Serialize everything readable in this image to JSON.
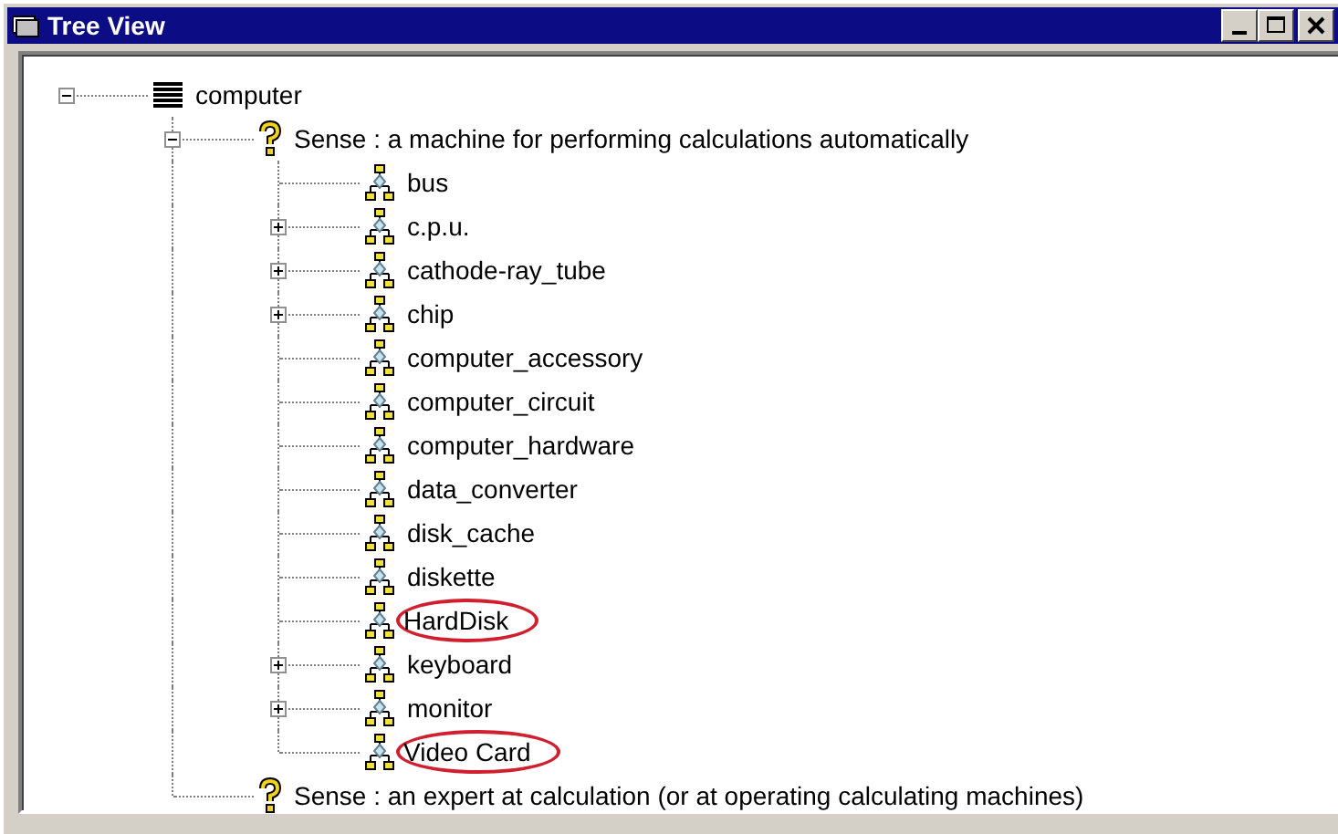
{
  "window": {
    "title": "Tree View"
  },
  "tree": [
    {
      "label": "computer",
      "kind": "word",
      "expanded": true,
      "circled": false,
      "children": [
        {
          "label": "Sense : a machine for performing calculations automatically",
          "kind": "sense",
          "expanded": true,
          "circled": false,
          "children": [
            {
              "label": "bus",
              "kind": "synset",
              "circled": false
            },
            {
              "label": "c.p.u.",
              "kind": "synset",
              "expanded": false,
              "circled": false
            },
            {
              "label": "cathode-ray_tube",
              "kind": "synset",
              "expanded": false,
              "circled": false
            },
            {
              "label": "chip",
              "kind": "synset",
              "expanded": false,
              "circled": false
            },
            {
              "label": "computer_accessory",
              "kind": "synset",
              "circled": false
            },
            {
              "label": "computer_circuit",
              "kind": "synset",
              "circled": false
            },
            {
              "label": "computer_hardware",
              "kind": "synset",
              "circled": false
            },
            {
              "label": "data_converter",
              "kind": "synset",
              "circled": false
            },
            {
              "label": "disk_cache",
              "kind": "synset",
              "circled": false
            },
            {
              "label": "diskette",
              "kind": "synset",
              "circled": false
            },
            {
              "label": "HardDisk",
              "kind": "synset",
              "circled": true
            },
            {
              "label": "keyboard",
              "kind": "synset",
              "expanded": false,
              "circled": false
            },
            {
              "label": "monitor",
              "kind": "synset",
              "expanded": false,
              "circled": false
            },
            {
              "label": "Video Card",
              "kind": "synset",
              "circled": true
            }
          ]
        },
        {
          "label": "Sense : an expert at calculation (or at operating calculating machines)",
          "kind": "sense",
          "circled": false
        }
      ]
    }
  ]
}
